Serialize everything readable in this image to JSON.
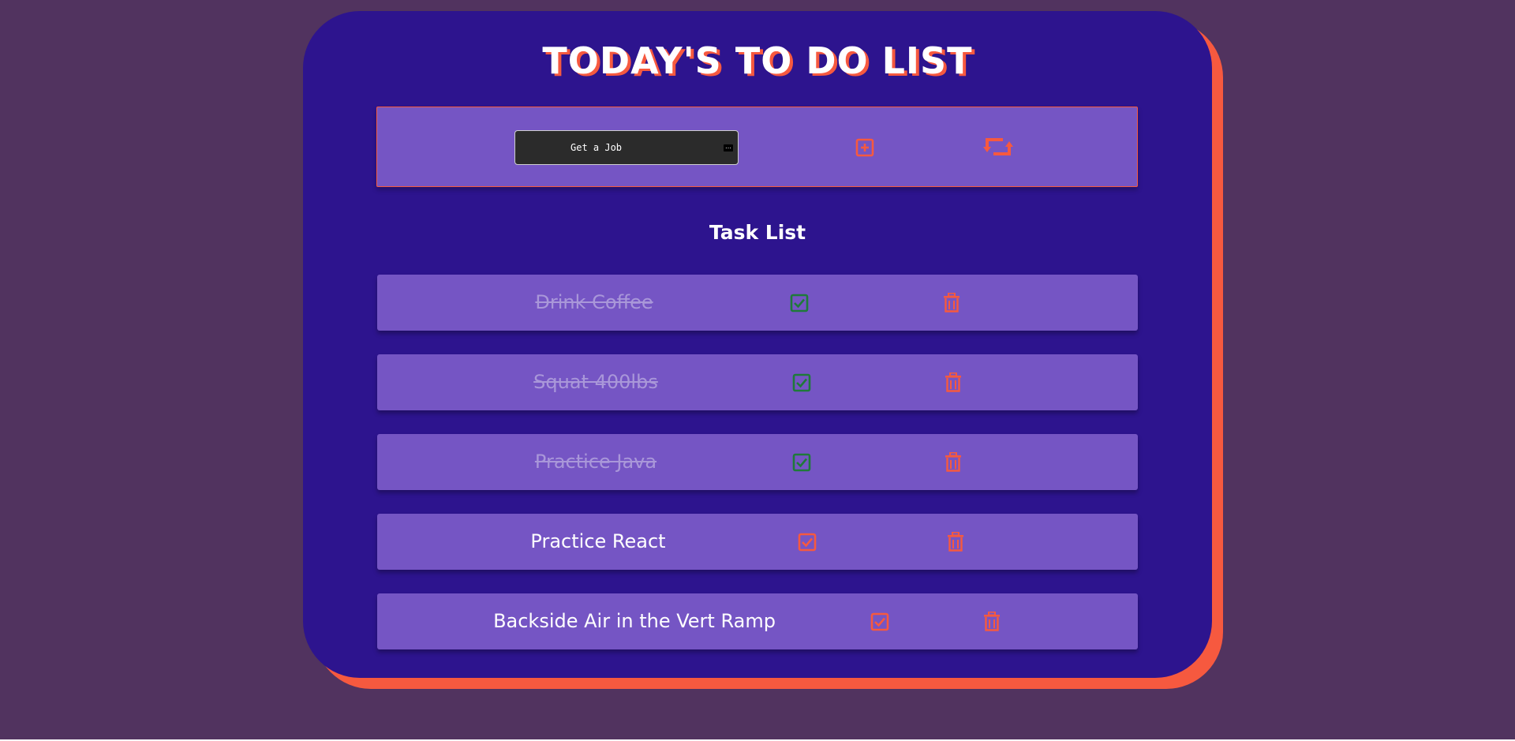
{
  "header": {
    "title": "TODAY'S TO DO LIST"
  },
  "input_panel": {
    "task_input_value": "Get a Job",
    "task_input_placeholder": ""
  },
  "task_list": {
    "heading": "Task List",
    "tasks": [
      {
        "text": "Drink Coffee",
        "completed": true
      },
      {
        "text": "Squat 400lbs",
        "completed": true
      },
      {
        "text": "Practice Java",
        "completed": true
      },
      {
        "text": "Practice React",
        "completed": false
      },
      {
        "text": "Backside Air in the Vert Ramp",
        "completed": false
      }
    ]
  },
  "icons": {
    "add": "plus-square-icon",
    "refresh": "repeat-icon",
    "complete": "check-square-icon",
    "delete": "trash-icon"
  },
  "colors": {
    "background": "#51335f",
    "card": "#2d148e",
    "card_shadow": "#f6593f",
    "panel": "#7555c4",
    "accent": "#f6593f",
    "check_done": "#1f7a3a",
    "text_done": "#a997d9",
    "text": "#ffffff"
  }
}
